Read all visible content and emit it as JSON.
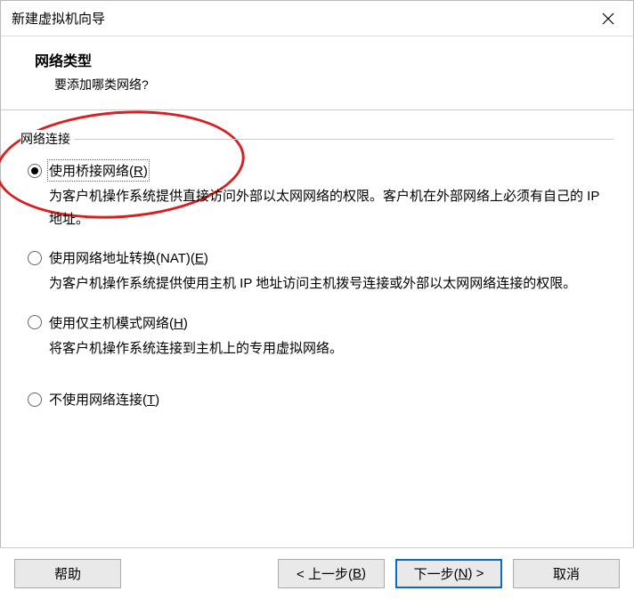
{
  "titlebar": {
    "title": "新建虚拟机向导"
  },
  "header": {
    "title": "网络类型",
    "subtitle": "要添加哪类网络?"
  },
  "fieldset": {
    "legend": "网络连接"
  },
  "options": {
    "bridge": {
      "label_pre": "使用桥接网络(",
      "label_key": "R",
      "label_post": ")",
      "desc": "为客户机操作系统提供直接访问外部以太网网络的权限。客户机在外部网络上必须有自己的 IP 地址。"
    },
    "nat": {
      "label_pre": "使用网络地址转换(NAT)(",
      "label_key": "E",
      "label_post": ")",
      "desc": "为客户机操作系统提供使用主机 IP 地址访问主机拨号连接或外部以太网网络连接的权限。"
    },
    "hostonly": {
      "label_pre": "使用仅主机模式网络(",
      "label_key": "H",
      "label_post": ")",
      "desc": "将客户机操作系统连接到主机上的专用虚拟网络。"
    },
    "none": {
      "label_pre": "不使用网络连接(",
      "label_key": "T",
      "label_post": ")"
    }
  },
  "buttons": {
    "help": "帮助",
    "back_pre": "< 上一步(",
    "back_key": "B",
    "back_post": ")",
    "next_pre": "下一步(",
    "next_key": "N",
    "next_post": ") >",
    "cancel": "取消"
  }
}
